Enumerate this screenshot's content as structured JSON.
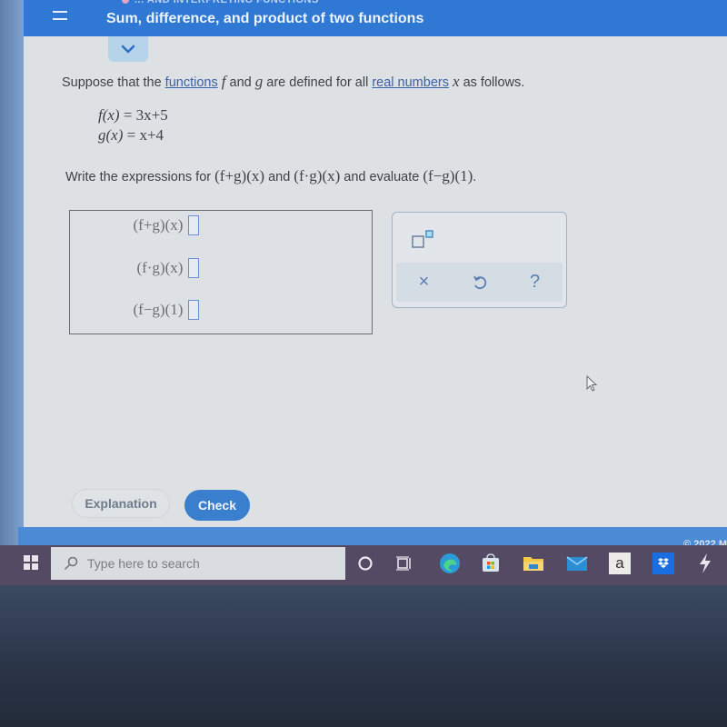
{
  "header": {
    "breadcrumb": "... AND INTERPRETING FUNCTIONS",
    "title": "Sum, difference, and product of two functions",
    "accent_color": "#2f78d4"
  },
  "question": {
    "intro_before": "Suppose that the ",
    "link_functions": "functions",
    "f": "f",
    "and": " and ",
    "g": "g",
    "intro_mid": " are defined for all ",
    "link_real_numbers": "real numbers",
    "x": "x",
    "intro_after": " as follows.",
    "definitions": [
      {
        "lhs": "f(x)",
        "rhs": "= 3x+5"
      },
      {
        "lhs": "g(x)",
        "rhs": "= x+4"
      }
    ],
    "instruction_before": "Write the expressions for ",
    "expr1": "(f+g)(x)",
    "instruction_mid1": " and ",
    "expr2": "(f·g)(x)",
    "instruction_mid2": " and evaluate ",
    "expr3": "(f−g)(1)",
    "instruction_end": "."
  },
  "answers": [
    {
      "label": "(f+g)(x)",
      "equals": "=",
      "value": ""
    },
    {
      "label": "(f·g)(x)",
      "equals": "=",
      "value": ""
    },
    {
      "label": "(f−g)(1)",
      "equals": "=",
      "value": ""
    }
  ],
  "toolbox": {
    "superscript_icon": "superscript-icon",
    "clear_symbol": "×",
    "undo_symbol": "↺",
    "help_symbol": "?"
  },
  "buttons": {
    "explanation": "Explanation",
    "check": "Check"
  },
  "footer": {
    "copyright": "© 2022 M"
  },
  "taskbar": {
    "search_placeholder": "Type here to search",
    "icons": [
      "windows-start-icon",
      "cortana-icon",
      "task-view-icon",
      "edge-icon",
      "store-icon",
      "file-explorer-icon",
      "mail-icon",
      "amazon-icon",
      "dropbox-icon",
      "app-icon"
    ],
    "amazon_label": "a"
  }
}
